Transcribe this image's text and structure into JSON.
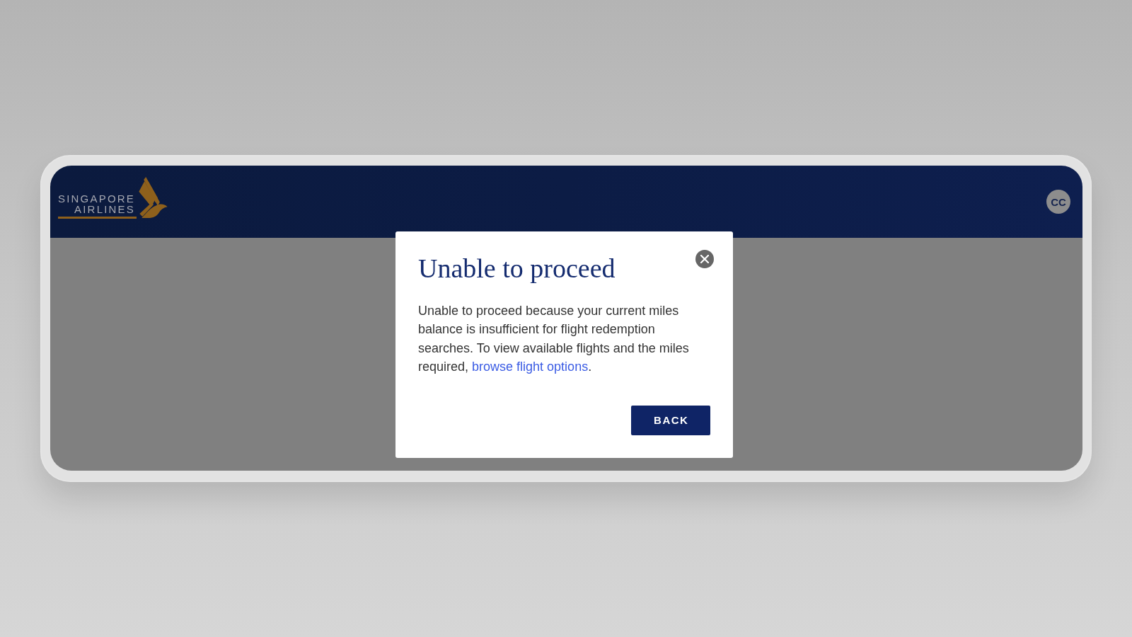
{
  "header": {
    "logo": {
      "lines": [
        "SINGAPORE",
        "AIRLINES"
      ]
    },
    "avatar": {
      "initials": "CC"
    }
  },
  "dialog": {
    "title": "Unable to proceed",
    "message": "Unable to proceed because your current miles balance is insufficient for flight redemption searches. To view available flights and the miles required, ",
    "link": "browse flight options",
    "message_end": ".",
    "button": "BACK"
  }
}
